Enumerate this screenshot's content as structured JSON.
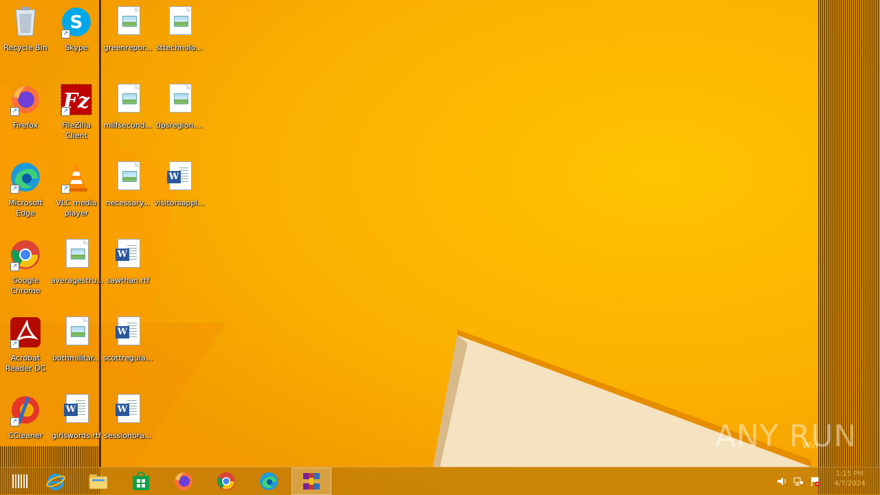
{
  "desktop": {
    "icons": [
      {
        "label": "Recycle Bin"
      },
      {
        "label": "Skype"
      },
      {
        "label": "greenrepor..."
      },
      {
        "label": "sttechnolo..."
      },
      {
        "label": "Firefox"
      },
      {
        "label": "FileZilla\nClient"
      },
      {
        "label": "milfsecond..."
      },
      {
        "label": "tipsregion...."
      },
      {
        "label": "Microsoft\nEdge"
      },
      {
        "label": "VLC media\nplayer"
      },
      {
        "label": "necessary..."
      },
      {
        "label": "visitorsappl..."
      },
      {
        "label": "Google\nChrome"
      },
      {
        "label": "averagestru..."
      },
      {
        "label": "sawthan.rtf"
      },
      {
        "label": "Acrobat\nReader DC"
      },
      {
        "label": "bothmilitar..."
      },
      {
        "label": "scottregula..."
      },
      {
        "label": "CCleaner"
      },
      {
        "label": "girlswords.rtf"
      },
      {
        "label": "sessionbra..."
      }
    ]
  },
  "taskbar": {
    "items": [
      {
        "name": "Start"
      },
      {
        "name": "Internet Explorer"
      },
      {
        "name": "File Explorer"
      },
      {
        "name": "Store"
      },
      {
        "name": "Firefox"
      },
      {
        "name": "Google Chrome"
      },
      {
        "name": "Microsoft Edge"
      },
      {
        "name": "WinRAR"
      }
    ],
    "clock_time": "1:15 PM",
    "clock_date": "4/7/2024"
  },
  "watermark": {
    "text": "ANY RUN",
    "sub": "Win"
  }
}
